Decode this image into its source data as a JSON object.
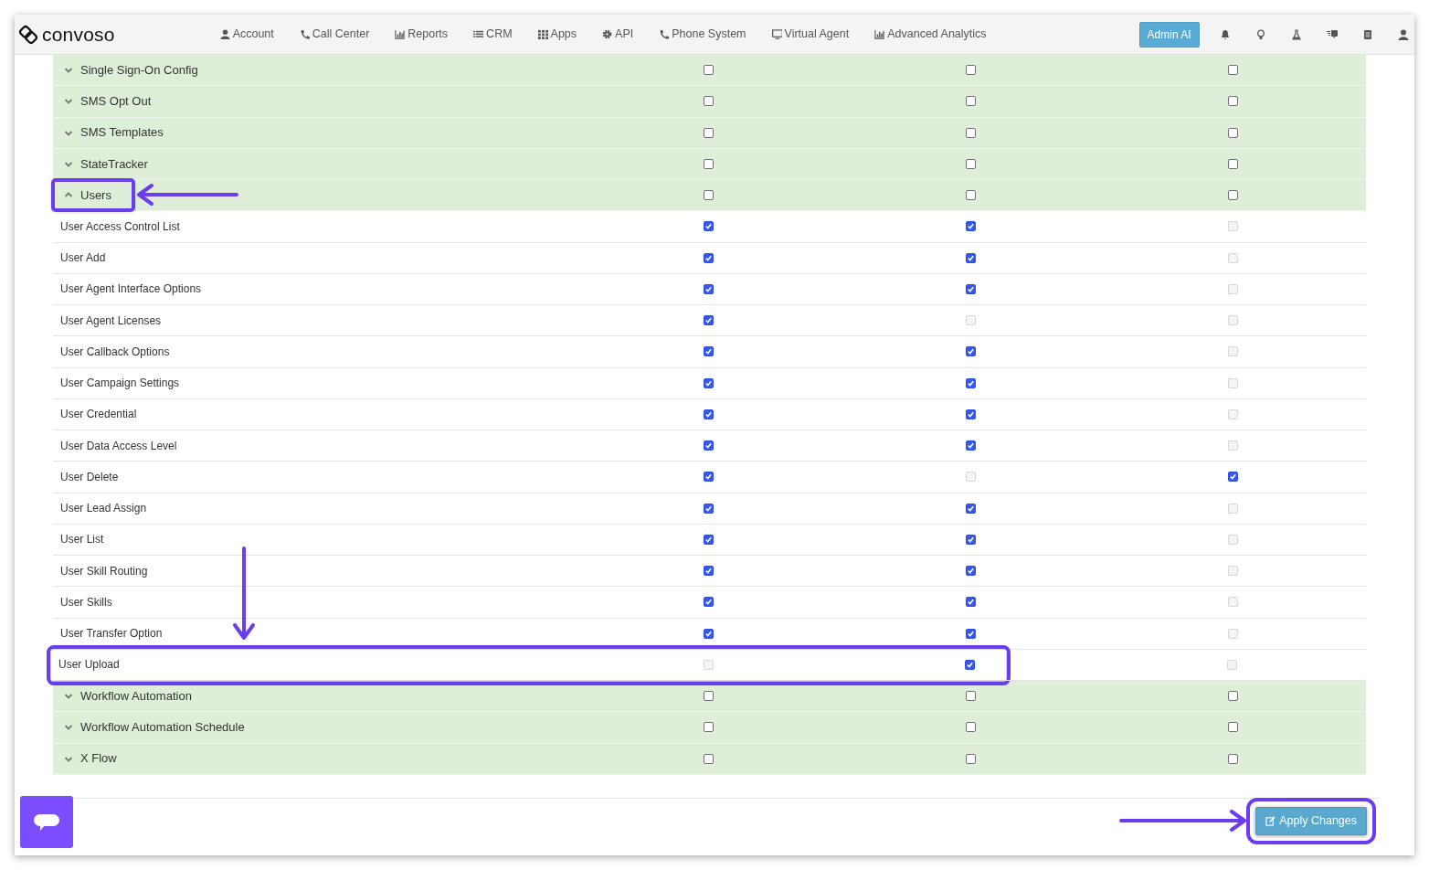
{
  "brand": "convoso",
  "nav": [
    {
      "label": "Account"
    },
    {
      "label": "Call Center"
    },
    {
      "label": "Reports"
    },
    {
      "label": "CRM"
    },
    {
      "label": "Apps"
    },
    {
      "label": "API"
    },
    {
      "label": "Phone System"
    },
    {
      "label": "Virtual Agent"
    },
    {
      "label": "Advanced Analytics"
    }
  ],
  "admin_button": "Admin AI",
  "groups": [
    {
      "label": "Single Sign-On Config",
      "expanded": false,
      "highlighted": false,
      "checks": [
        {
          "checked": false,
          "disabled": false
        },
        {
          "checked": false,
          "disabled": false
        },
        {
          "checked": false,
          "disabled": false
        }
      ]
    },
    {
      "label": "SMS Opt Out",
      "expanded": false,
      "highlighted": false,
      "checks": [
        {
          "checked": false,
          "disabled": false
        },
        {
          "checked": false,
          "disabled": false
        },
        {
          "checked": false,
          "disabled": false
        }
      ]
    },
    {
      "label": "SMS Templates",
      "expanded": false,
      "highlighted": false,
      "checks": [
        {
          "checked": false,
          "disabled": false
        },
        {
          "checked": false,
          "disabled": false
        },
        {
          "checked": false,
          "disabled": false
        }
      ]
    },
    {
      "label": "StateTracker",
      "expanded": false,
      "highlighted": false,
      "checks": [
        {
          "checked": false,
          "disabled": false
        },
        {
          "checked": false,
          "disabled": false
        },
        {
          "checked": false,
          "disabled": false
        }
      ]
    },
    {
      "label": "Users",
      "expanded": true,
      "highlighted": true,
      "checks": [
        {
          "checked": false,
          "disabled": false
        },
        {
          "checked": false,
          "disabled": false
        },
        {
          "checked": false,
          "disabled": false
        }
      ],
      "children": [
        {
          "label": "User Access Control List",
          "highlighted": false,
          "checks": [
            {
              "checked": true,
              "disabled": false
            },
            {
              "checked": true,
              "disabled": false
            },
            {
              "checked": false,
              "disabled": true
            }
          ]
        },
        {
          "label": "User Add",
          "highlighted": false,
          "checks": [
            {
              "checked": true,
              "disabled": false
            },
            {
              "checked": true,
              "disabled": false
            },
            {
              "checked": false,
              "disabled": true
            }
          ]
        },
        {
          "label": "User Agent Interface Options",
          "highlighted": false,
          "checks": [
            {
              "checked": true,
              "disabled": false
            },
            {
              "checked": true,
              "disabled": false
            },
            {
              "checked": false,
              "disabled": true
            }
          ]
        },
        {
          "label": "User Agent Licenses",
          "highlighted": false,
          "checks": [
            {
              "checked": true,
              "disabled": false
            },
            {
              "checked": false,
              "disabled": true
            },
            {
              "checked": false,
              "disabled": true
            }
          ]
        },
        {
          "label": "User Callback Options",
          "highlighted": false,
          "checks": [
            {
              "checked": true,
              "disabled": false
            },
            {
              "checked": true,
              "disabled": false
            },
            {
              "checked": false,
              "disabled": true
            }
          ]
        },
        {
          "label": "User Campaign Settings",
          "highlighted": false,
          "checks": [
            {
              "checked": true,
              "disabled": false
            },
            {
              "checked": true,
              "disabled": false
            },
            {
              "checked": false,
              "disabled": true
            }
          ]
        },
        {
          "label": "User Credential",
          "highlighted": false,
          "checks": [
            {
              "checked": true,
              "disabled": false
            },
            {
              "checked": true,
              "disabled": false
            },
            {
              "checked": false,
              "disabled": true
            }
          ]
        },
        {
          "label": "User Data Access Level",
          "highlighted": false,
          "checks": [
            {
              "checked": true,
              "disabled": false
            },
            {
              "checked": true,
              "disabled": false
            },
            {
              "checked": false,
              "disabled": true
            }
          ]
        },
        {
          "label": "User Delete",
          "highlighted": false,
          "checks": [
            {
              "checked": true,
              "disabled": false
            },
            {
              "checked": false,
              "disabled": true
            },
            {
              "checked": true,
              "disabled": false
            }
          ]
        },
        {
          "label": "User Lead Assign",
          "highlighted": false,
          "checks": [
            {
              "checked": true,
              "disabled": false
            },
            {
              "checked": true,
              "disabled": false
            },
            {
              "checked": false,
              "disabled": true
            }
          ]
        },
        {
          "label": "User List",
          "highlighted": false,
          "checks": [
            {
              "checked": true,
              "disabled": false
            },
            {
              "checked": true,
              "disabled": false
            },
            {
              "checked": false,
              "disabled": true
            }
          ]
        },
        {
          "label": "User Skill Routing",
          "highlighted": false,
          "checks": [
            {
              "checked": true,
              "disabled": false
            },
            {
              "checked": true,
              "disabled": false
            },
            {
              "checked": false,
              "disabled": true
            }
          ]
        },
        {
          "label": "User Skills",
          "highlighted": false,
          "checks": [
            {
              "checked": true,
              "disabled": false
            },
            {
              "checked": true,
              "disabled": false
            },
            {
              "checked": false,
              "disabled": true
            }
          ]
        },
        {
          "label": "User Transfer Option",
          "highlighted": false,
          "checks": [
            {
              "checked": true,
              "disabled": false
            },
            {
              "checked": true,
              "disabled": false
            },
            {
              "checked": false,
              "disabled": true
            }
          ]
        },
        {
          "label": "User Upload",
          "highlighted": true,
          "checks": [
            {
              "checked": false,
              "disabled": true
            },
            {
              "checked": true,
              "disabled": false
            },
            {
              "checked": false,
              "disabled": true
            }
          ]
        }
      ]
    },
    {
      "label": "Workflow Automation",
      "expanded": false,
      "highlighted": false,
      "checks": [
        {
          "checked": false,
          "disabled": false
        },
        {
          "checked": false,
          "disabled": false
        },
        {
          "checked": false,
          "disabled": false
        }
      ]
    },
    {
      "label": "Workflow Automation Schedule",
      "expanded": false,
      "highlighted": false,
      "checks": [
        {
          "checked": false,
          "disabled": false
        },
        {
          "checked": false,
          "disabled": false
        },
        {
          "checked": false,
          "disabled": false
        }
      ]
    },
    {
      "label": "X Flow",
      "expanded": false,
      "highlighted": false,
      "checks": [
        {
          "checked": false,
          "disabled": false
        },
        {
          "checked": false,
          "disabled": false
        },
        {
          "checked": false,
          "disabled": false
        }
      ]
    }
  ],
  "apply_button": {
    "label": "Apply Changes",
    "highlighted": true
  }
}
